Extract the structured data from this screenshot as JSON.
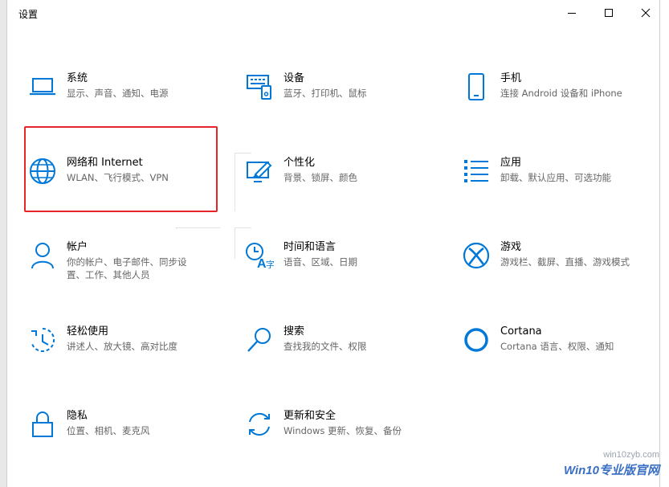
{
  "window": {
    "title": "设置"
  },
  "controls": {
    "minimize": "minimize",
    "maximize": "maximize",
    "close": "close"
  },
  "tiles": [
    {
      "name": "系统",
      "desc": "显示、声音、通知、电源",
      "icon": "laptop-icon"
    },
    {
      "name": "设备",
      "desc": "蓝牙、打印机、鼠标",
      "icon": "keyboard-icon"
    },
    {
      "name": "手机",
      "desc": "连接 Android 设备和 iPhone",
      "icon": "phone-icon"
    },
    {
      "name": "网络和 Internet",
      "desc": "WLAN、飞行模式、VPN",
      "icon": "globe-icon"
    },
    {
      "name": "个性化",
      "desc": "背景、锁屏、颜色",
      "icon": "paint-icon"
    },
    {
      "name": "应用",
      "desc": "卸载、默认应用、可选功能",
      "icon": "apps-list-icon"
    },
    {
      "name": "帐户",
      "desc": "你的帐户、电子邮件、同步设置、工作、其他人员",
      "icon": "person-icon"
    },
    {
      "name": "时间和语言",
      "desc": "语音、区域、日期",
      "icon": "time-language-icon"
    },
    {
      "name": "游戏",
      "desc": "游戏栏、截屏、直播、游戏模式",
      "icon": "xbox-icon"
    },
    {
      "name": "轻松使用",
      "desc": "讲述人、放大镜、高对比度",
      "icon": "ease-of-access-icon"
    },
    {
      "name": "搜索",
      "desc": "查找我的文件、权限",
      "icon": "search-icon"
    },
    {
      "name": "Cortana",
      "desc": "Cortana 语言、权限、通知",
      "icon": "cortana-icon"
    },
    {
      "name": "隐私",
      "desc": "位置、相机、麦克风",
      "icon": "lock-icon"
    },
    {
      "name": "更新和安全",
      "desc": "Windows 更新、恢复、备份",
      "icon": "update-icon"
    }
  ],
  "watermark": {
    "url": "win10zyb.com",
    "brand": "Win10专业版官网"
  },
  "colors": {
    "accent": "#0078d7",
    "highlight": "#e5252a"
  }
}
